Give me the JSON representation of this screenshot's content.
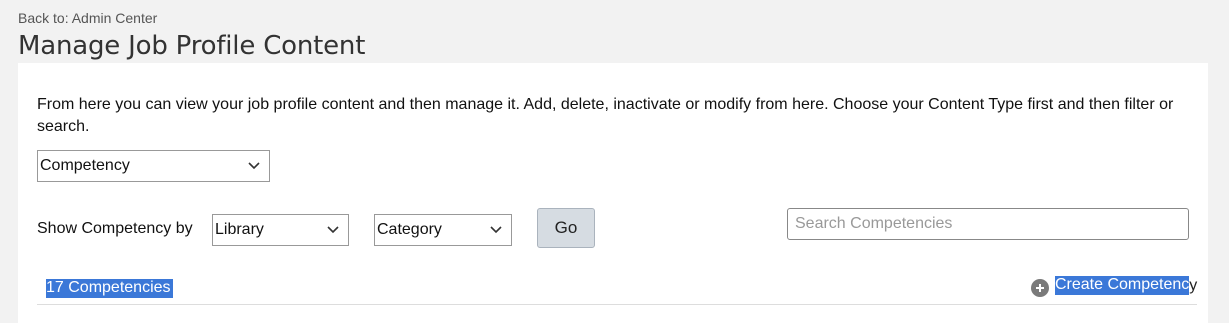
{
  "nav": {
    "back_label": "Back to: Admin Center"
  },
  "page": {
    "title": "Manage Job Profile Content"
  },
  "intro": {
    "description": "From here you can view your job profile content and then manage it. Add, delete, inactivate or modify from here. Choose your Content Type first and then filter or search."
  },
  "content_type": {
    "selected": "Competency"
  },
  "filters": {
    "show_label": "Show Competency by",
    "library_selected": "Library",
    "category_selected": "Category",
    "go_label": "Go"
  },
  "search": {
    "placeholder": "Search Competencies",
    "value": ""
  },
  "results": {
    "count_label": "17 Competencies",
    "create_label_selected": "Create Competenc",
    "create_label_rest": "y"
  },
  "icons": {
    "dropdown": "chevron-down-icon",
    "create": "plus-circle-icon"
  },
  "colors": {
    "selection": "#3b78d8",
    "go_button": "#d6dce2"
  }
}
